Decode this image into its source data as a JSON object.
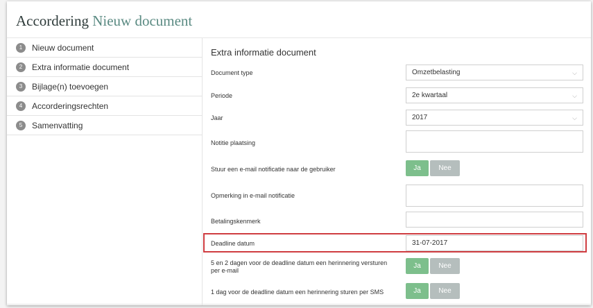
{
  "header": {
    "title_main": "Accordering",
    "title_doc": "Nieuw document"
  },
  "sidebar": {
    "steps": [
      {
        "num": "1",
        "label": "Nieuw document"
      },
      {
        "num": "2",
        "label": "Extra informatie document"
      },
      {
        "num": "3",
        "label": "Bijlage(n) toevoegen"
      },
      {
        "num": "4",
        "label": "Accorderingsrechten"
      },
      {
        "num": "5",
        "label": "Samenvatting"
      }
    ]
  },
  "form": {
    "title": "Extra informatie document",
    "document_type": {
      "label": "Document type",
      "value": "Omzetbelasting"
    },
    "periode": {
      "label": "Periode",
      "value": "2e kwartaal"
    },
    "jaar": {
      "label": "Jaar",
      "value": "2017"
    },
    "notitie": {
      "label": "Notitie plaatsing",
      "value": ""
    },
    "email_notificatie": {
      "label": "Stuur een e-mail notificatie naar de gebruiker",
      "yes": "Ja",
      "no": "Nee"
    },
    "opmerking": {
      "label": "Opmerking in e-mail notificatie",
      "value": ""
    },
    "betalingskenmerk": {
      "label": "Betalingskenmerk",
      "value": ""
    },
    "deadline": {
      "label": "Deadline datum",
      "value": "31-07-2017"
    },
    "herinnering_email": {
      "label": "5 en 2 dagen voor de deadline datum een herinnering versturen per e-mail",
      "yes": "Ja",
      "no": "Nee"
    },
    "herinnering_sms": {
      "label": "1 dag voor de deadline datum een herinnering sturen per SMS",
      "yes": "Ja",
      "no": "Nee"
    }
  },
  "colors": {
    "accent_green": "#7dbf8c",
    "neutral_gray": "#b5bebd",
    "highlight_red": "#cf3c40",
    "title_doc": "#5a8a82"
  }
}
